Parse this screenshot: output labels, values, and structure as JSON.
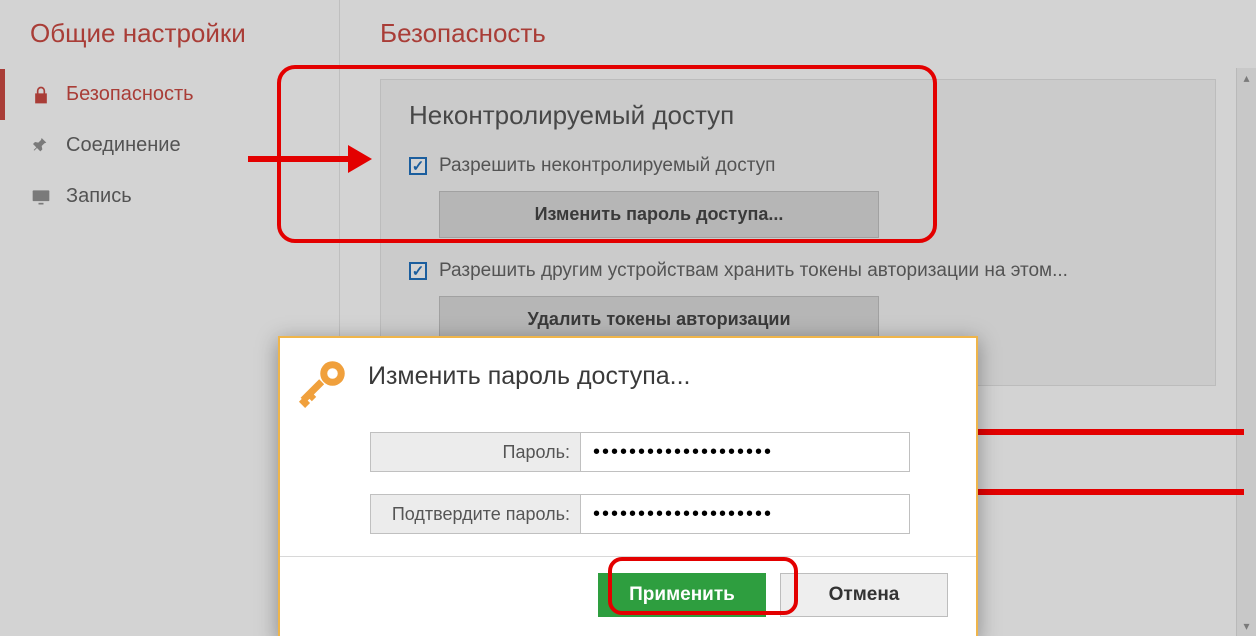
{
  "sidebar": {
    "title": "Общие настройки",
    "items": [
      {
        "label": "Безопасность",
        "icon": "lock-icon",
        "active": true
      },
      {
        "label": "Соединение",
        "icon": "pin-icon",
        "active": false
      },
      {
        "label": "Запись",
        "icon": "monitor-icon",
        "active": false
      }
    ]
  },
  "main": {
    "title": "Безопасность",
    "section_title": "Неконтролируемый доступ",
    "check1_label": "Разрешить неконтролируемый доступ",
    "change_pw_btn": "Изменить пароль доступа...",
    "check2_label": "Разрешить другим устройствам хранить токены авторизации на этом...",
    "delete_tokens_btn": "Удалить токены авторизации"
  },
  "dialog": {
    "title": "Изменить пароль доступа...",
    "password_label": "Пароль:",
    "confirm_label": "Подтвердите пароль:",
    "password_mask": "●●●●●●●●●●●●●●●●●●●●",
    "apply": "Применить",
    "cancel": "Отмена"
  }
}
